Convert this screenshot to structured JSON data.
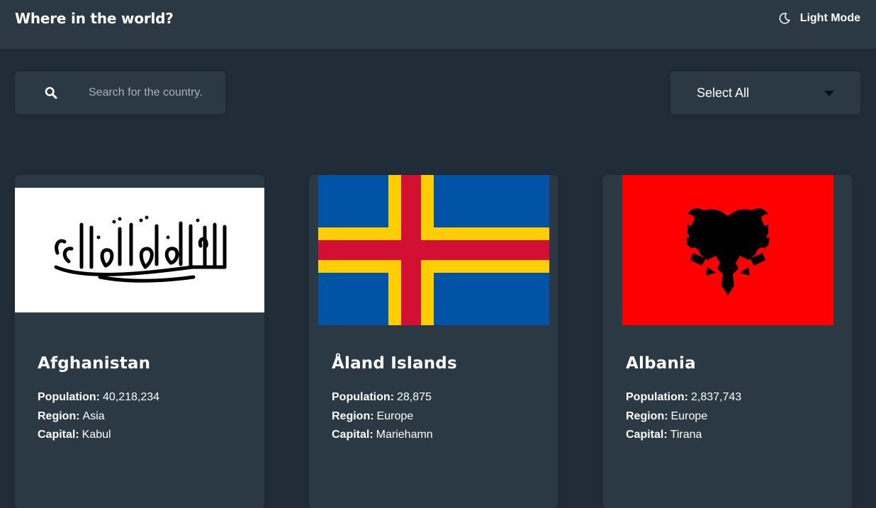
{
  "header": {
    "title": "Where in the world?",
    "theme_toggle_label": "Light Mode",
    "theme_icon": "moon-icon"
  },
  "search": {
    "placeholder": "Search for the country.",
    "value": "",
    "icon": "search-icon"
  },
  "filter": {
    "selected": "Select All",
    "icon": "caret-down-icon"
  },
  "labels": {
    "population": "Population:",
    "region": "Region:",
    "capital": "Capital:"
  },
  "countries": [
    {
      "name": "Afghanistan",
      "population": "40,218,234",
      "region": "Asia",
      "capital": "Kabul",
      "flag": "afghanistan-flag"
    },
    {
      "name": "Åland Islands",
      "population": "28,875",
      "region": "Europe",
      "capital": "Mariehamn",
      "flag": "aland-islands-flag"
    },
    {
      "name": "Albania",
      "population": "2,837,743",
      "region": "Europe",
      "capital": "Tirana",
      "flag": "albania-flag"
    }
  ],
  "colors": {
    "background": "#202c37",
    "elements": "#2b3945",
    "text": "#ffffff",
    "aland_blue": "#0053a5",
    "aland_yellow": "#ffce00",
    "aland_red": "#d21034",
    "albania_red": "#ff0000"
  }
}
